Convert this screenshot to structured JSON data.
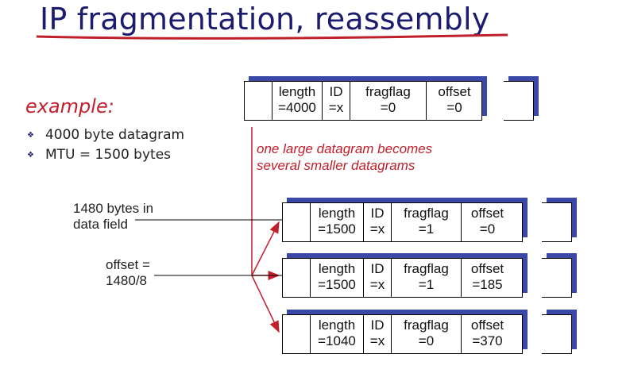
{
  "title": "IP fragmentation, reassembly",
  "example_label": "example:",
  "bullets": [
    "4000 byte datagram",
    "MTU = 1500 bytes"
  ],
  "note": [
    "one large datagram becomes",
    "several smaller datagrams"
  ],
  "side_labels": {
    "data_field": [
      "1480 bytes in",
      "data field"
    ],
    "offset_calc": [
      "offset =",
      "1480/8"
    ]
  },
  "field_names": {
    "length": "length",
    "id": "ID",
    "fragflag": "fragflag",
    "offset": "offset"
  },
  "original": {
    "length": "=4000",
    "id": "=x",
    "fragflag": "=0",
    "offset": "=0"
  },
  "fragments": [
    {
      "length": "=1500",
      "id": "=x",
      "fragflag": "=1",
      "offset": "=0"
    },
    {
      "length": "=1500",
      "id": "=x",
      "fragflag": "=1",
      "offset": "=185"
    },
    {
      "length": "=1040",
      "id": "=x",
      "fragflag": "=0",
      "offset": "=370"
    }
  ],
  "colors": {
    "title": "#1c1c6e",
    "accent_red": "#c0202c",
    "shadow_blue": "#3a49a8"
  },
  "icons": {
    "bullet": "diamond-bullet-icon"
  }
}
